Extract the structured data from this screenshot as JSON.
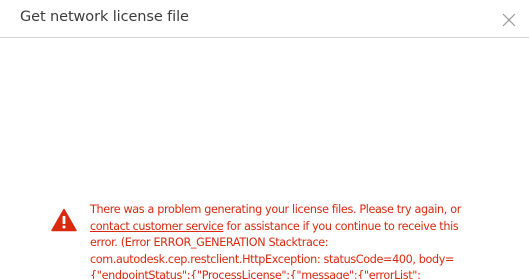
{
  "dialog": {
    "title": "Get network license file",
    "close_icon": "close-icon"
  },
  "error": {
    "icon": "warning-icon",
    "color": "#d9290f",
    "line1": "There was a problem generating your license files. Please try again, or",
    "link_text": "contact customer service",
    "line2_rest": " for assistance if you continue to receive this",
    "line3": "error. (Error ERROR_GENERATION Stacktrace:",
    "line4": "com.autodesk.cep.restclient.HttpException: statusCode=400, body=",
    "line5": "{\"endpointStatus\":{\"ProcessLicense\":{\"message\":{\"errorList\":"
  }
}
